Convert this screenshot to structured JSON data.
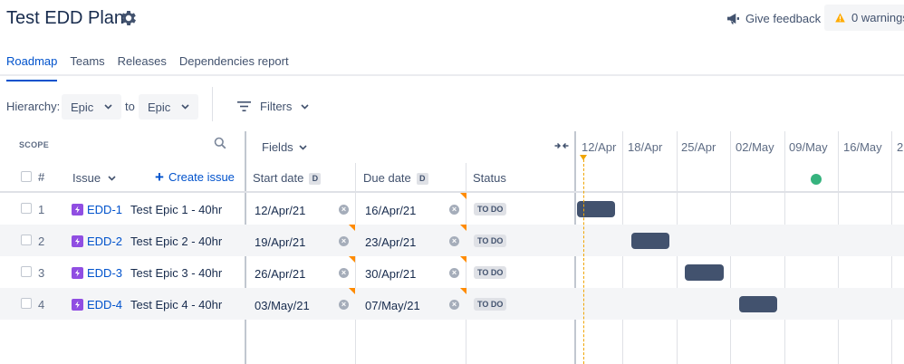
{
  "header": {
    "title": "Test EDD Plan",
    "feedback_label": "Give feedback",
    "warnings_label": "0 warnings"
  },
  "tabs": [
    {
      "label": "Roadmap",
      "active": true
    },
    {
      "label": "Teams",
      "active": false
    },
    {
      "label": "Releases",
      "active": false
    },
    {
      "label": "Dependencies report",
      "active": false
    }
  ],
  "hierarchy": {
    "label": "Hierarchy:",
    "from_value": "Epic",
    "to_label": "to",
    "to_value": "Epic"
  },
  "filters_label": "Filters",
  "scope": {
    "title": "SCOPE",
    "fields_label": "Fields",
    "columns": {
      "number": "#",
      "issue": "Issue",
      "create_issue": "Create issue",
      "start_date": "Start date",
      "due_date": "Due date",
      "status": "Status",
      "date_badge": "D"
    }
  },
  "timeline": {
    "weeks": [
      "12/Apr",
      "18/Apr",
      "25/Apr",
      "02/May",
      "09/May",
      "16/May",
      "2"
    ]
  },
  "issues": [
    {
      "num": "1",
      "key": "EDD-1",
      "summary": "Test Epic 1 - 40hr",
      "start": "12/Apr/21",
      "due": "16/Apr/21",
      "status": "TO DO"
    },
    {
      "num": "2",
      "key": "EDD-2",
      "summary": "Test Epic 2 - 40hr",
      "start": "19/Apr/21",
      "due": "23/Apr/21",
      "status": "TO DO"
    },
    {
      "num": "3",
      "key": "EDD-3",
      "summary": "Test Epic 3 - 40hr",
      "start": "26/Apr/21",
      "due": "30/Apr/21",
      "status": "TO DO"
    },
    {
      "num": "4",
      "key": "EDD-4",
      "summary": "Test Epic 4 - 40hr",
      "start": "03/May/21",
      "due": "07/May/21",
      "status": "TO DO"
    }
  ],
  "colors": {
    "accent": "#0052cc",
    "epic": "#904ee2",
    "bar": "#42526e",
    "release": "#36b37e",
    "today": "#f0a500",
    "warning": "#ffab00"
  }
}
